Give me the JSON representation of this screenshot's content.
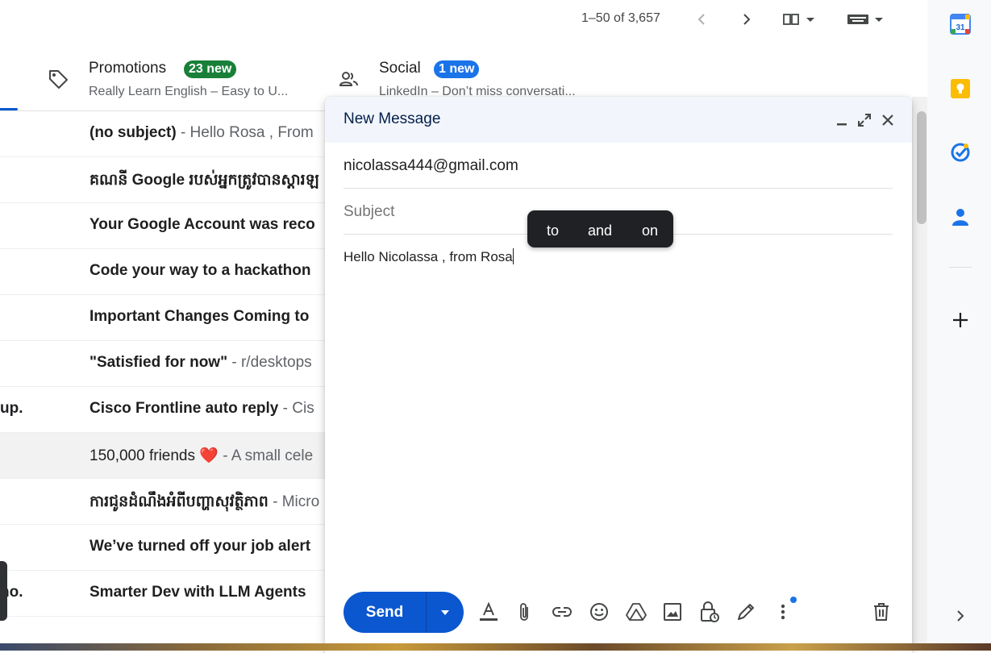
{
  "toolbar": {
    "pager": "1–50 of 3,657",
    "icons": [
      "chevron-left-icon",
      "chevron-right-icon",
      "split-pane-icon",
      "keyboard-icon"
    ]
  },
  "tabs": [
    {
      "title": "Promotions",
      "badge": "23 new",
      "badge_color": "#188038",
      "snippet": "Really Learn English – Easy to U...",
      "icon": "tag-icon"
    },
    {
      "title": "Social",
      "badge": "1 new",
      "badge_color": "#1a73e8",
      "snippet": "LinkedIn – Don’t miss conversati...",
      "icon": "people-icon"
    }
  ],
  "emails": [
    {
      "subject": "(no subject)",
      "snippet": " - Hello Rosa , From",
      "read": false,
      "sender": ""
    },
    {
      "subject": "គណនី Google របស់អ្នកត្រូវបានស្តារឡ",
      "snippet": "",
      "read": false,
      "sender": ""
    },
    {
      "subject": "Your Google Account was reco",
      "snippet": "",
      "read": false,
      "sender": ""
    },
    {
      "subject": "Code your way to a hackathon",
      "snippet": "",
      "read": false,
      "sender": ""
    },
    {
      "subject": "Important Changes Coming to",
      "snippet": "",
      "read": false,
      "sender": ""
    },
    {
      "subject": "\"Satisfied for now\"",
      "snippet": " - r/desktops",
      "read": false,
      "sender": ""
    },
    {
      "subject": "Cisco Frontline auto reply",
      "snippet": " - Cis",
      "read": false,
      "sender": "up."
    },
    {
      "subject": "150,000 friends ❤️",
      "snippet": " - A small cele",
      "read": true,
      "sender": ""
    },
    {
      "subject": "ការជូនដំណឹងអំពីបញ្ហាសុវត្ថិភាព",
      "snippet": " - Micro",
      "read": false,
      "sender": ""
    },
    {
      "subject": "We’ve turned off your job alert",
      "snippet": "",
      "read": false,
      "sender": ""
    },
    {
      "subject": "Smarter Dev with LLM Agents",
      "snippet": "",
      "read": false,
      "sender": "no."
    }
  ],
  "compose": {
    "title": "New Message",
    "to": "nicolassa444@gmail.com",
    "subject_placeholder": "Subject",
    "body": "Hello Nicolassa , from Rosa",
    "send_label": "Send",
    "suggestions": [
      "to",
      "and",
      "on"
    ],
    "format_icons": [
      "text-format-icon",
      "attach-icon",
      "link-icon",
      "emoji-icon",
      "drive-icon",
      "image-icon",
      "confidential-lock-icon",
      "signature-pen-icon",
      "more-options-icon"
    ],
    "delete_icon": "trash-icon"
  },
  "side_panel": {
    "calendar_day": "31",
    "icons": [
      "calendar-icon",
      "keep-icon",
      "tasks-icon",
      "contacts-icon",
      "add-icon",
      "expand-chevron-icon"
    ]
  },
  "colors": {
    "accent": "#0b57d0",
    "promotions_badge": "#188038",
    "social_badge": "#1a73e8",
    "compose_header": "#f2f6fc"
  }
}
